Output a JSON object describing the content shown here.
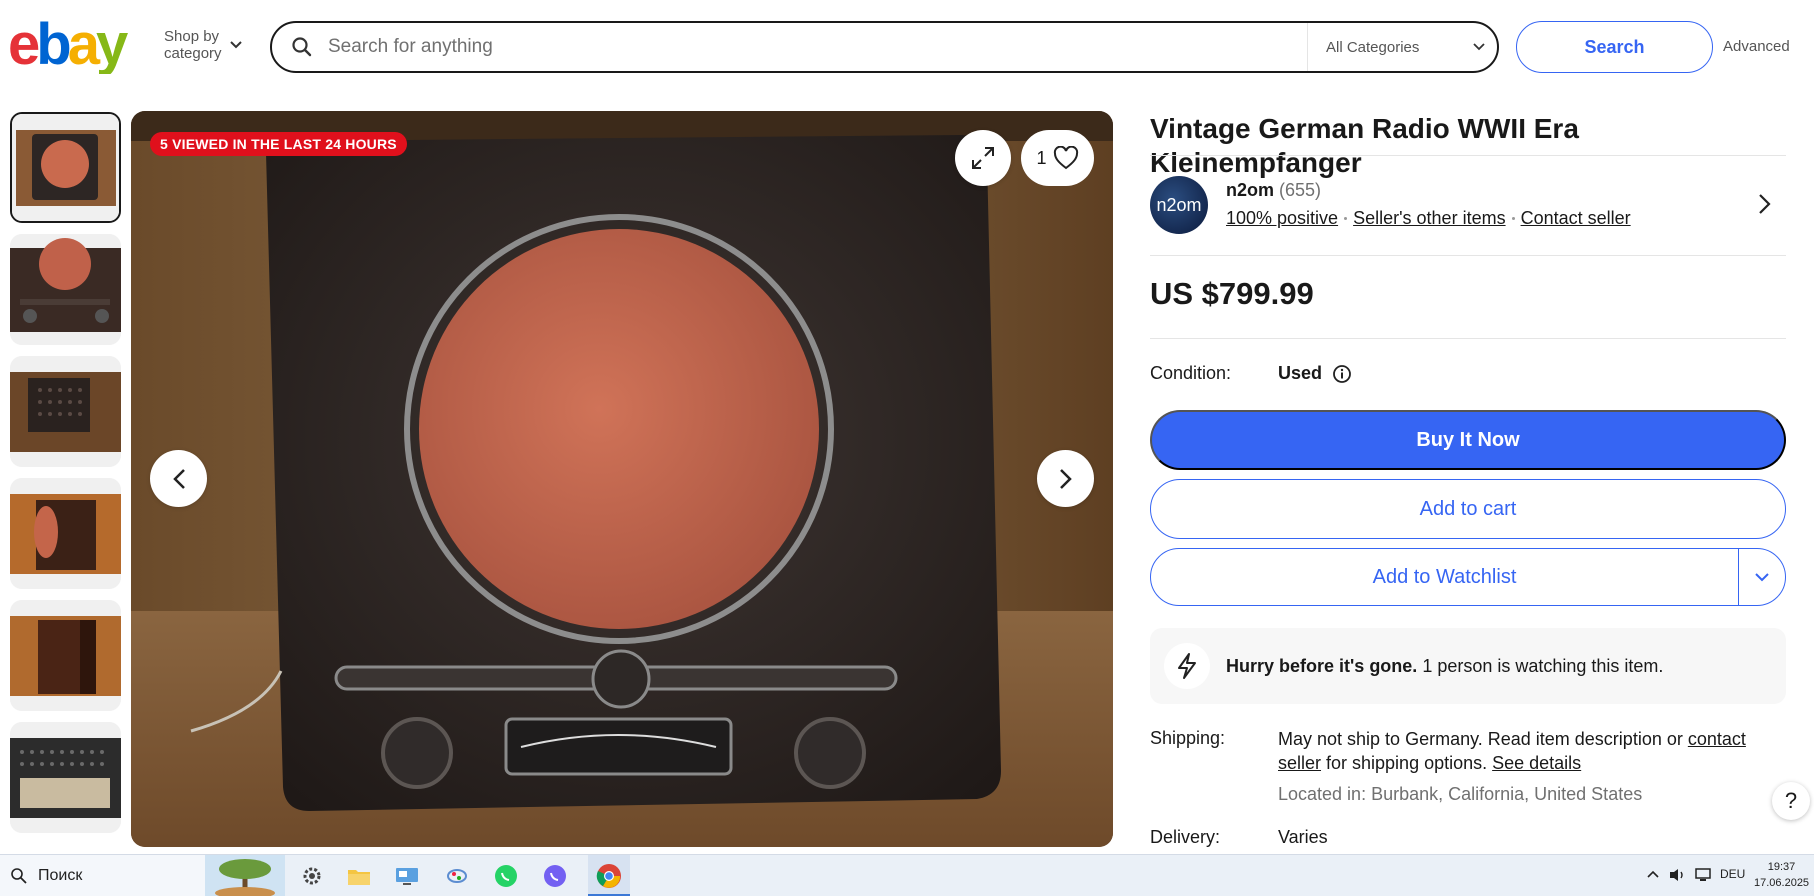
{
  "header": {
    "logo_letters": [
      "e",
      "b",
      "a",
      "y"
    ],
    "logo_colors": [
      "#e53238",
      "#0064d2",
      "#f5af02",
      "#86b817"
    ],
    "shop_by_category_line1": "Shop by",
    "shop_by_category_line2": "category",
    "search_placeholder": "Search for anything",
    "category_select": "All Categories",
    "search_button": "Search",
    "advanced_link": "Advanced"
  },
  "gallery": {
    "thumbnail_count": 6,
    "viewed_badge": "5 VIEWED IN THE LAST 24 HOURS",
    "watch_count": "1"
  },
  "listing": {
    "title": "Vintage German Radio WWII Era Kleinempfanger",
    "seller": {
      "avatar_text": "n2om",
      "name": "n2om",
      "feedback_count": "(655)",
      "positive": "100% positive",
      "other_items": "Seller's other items",
      "contact": "Contact seller"
    },
    "price": "US $799.99",
    "condition_label": "Condition:",
    "condition_value": "Used",
    "buy_now": "Buy It Now",
    "add_to_cart": "Add to cart",
    "add_to_watchlist": "Add to Watchlist",
    "hurry_bold": "Hurry before it's gone.",
    "hurry_text": " 1 person is watching this item.",
    "shipping_label": "Shipping:",
    "shipping_text_1": "May not ship to Germany. Read item description or ",
    "shipping_link_1": "contact seller",
    "shipping_text_2": " for shipping options. ",
    "shipping_link_2": "See details",
    "located": "Located in: Burbank, California, United States",
    "delivery_label": "Delivery:",
    "delivery_value": "Varies",
    "help": "?"
  },
  "taskbar": {
    "search_label": "Поиск",
    "language": "DEU",
    "time": "19:37",
    "date": "17.06.2025"
  },
  "colors": {
    "primary_blue": "#3665f3",
    "badge_red": "#e0101c"
  }
}
